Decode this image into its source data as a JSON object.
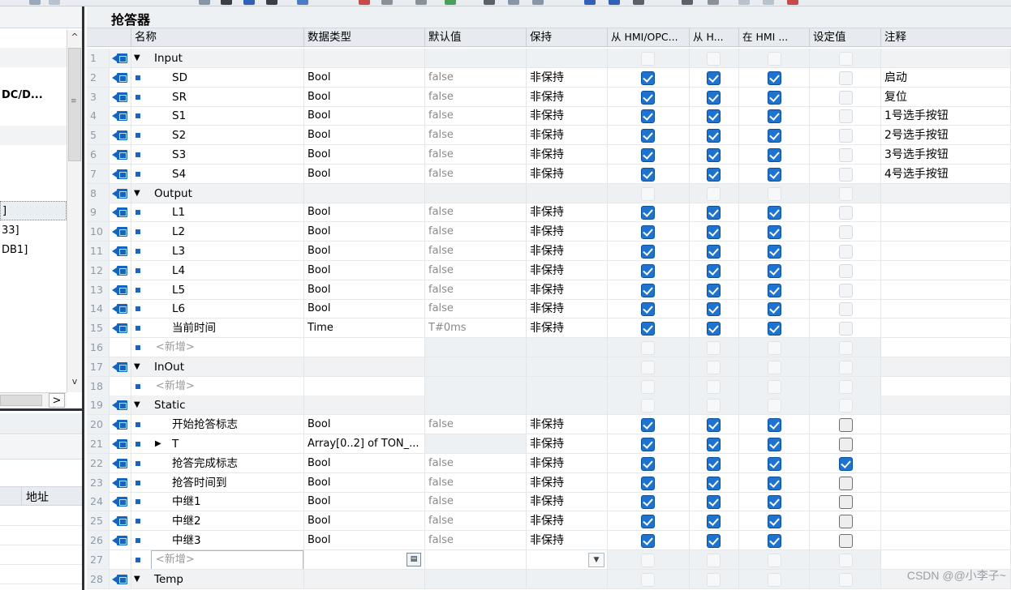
{
  "main": {
    "title": "抢答器",
    "columns": {
      "name": "名称",
      "datatype": "数据类型",
      "default": "默认值",
      "retain": "保持",
      "hmi_opc": "从 HMI/OPC...",
      "hmi2": "从 H...",
      "hmi3": "在 HMI ...",
      "setpoint": "设定值",
      "comment": "注释"
    },
    "rows": [
      {
        "num": "1",
        "icon": true,
        "kind": "group",
        "exp": "down",
        "name": "Input",
        "type": "",
        "def": "",
        "ret": "",
        "cb": [
          "off",
          "off",
          "off",
          "off"
        ],
        "cmt": ""
      },
      {
        "num": "2",
        "icon": true,
        "kind": "var",
        "name": "SD",
        "type": "Bool",
        "def": "false",
        "ret": "非保持",
        "cb": [
          "on",
          "on",
          "on",
          "off"
        ],
        "cmt": "启动"
      },
      {
        "num": "3",
        "icon": true,
        "kind": "var",
        "name": "SR",
        "type": "Bool",
        "def": "false",
        "ret": "非保持",
        "cb": [
          "on",
          "on",
          "on",
          "off"
        ],
        "cmt": "复位"
      },
      {
        "num": "4",
        "icon": true,
        "kind": "var",
        "name": "S1",
        "type": "Bool",
        "def": "false",
        "ret": "非保持",
        "cb": [
          "on",
          "on",
          "on",
          "off"
        ],
        "cmt": "1号选手按钮"
      },
      {
        "num": "5",
        "icon": true,
        "kind": "var",
        "name": "S2",
        "type": "Bool",
        "def": "false",
        "ret": "非保持",
        "cb": [
          "on",
          "on",
          "on",
          "off"
        ],
        "cmt": "2号选手按钮"
      },
      {
        "num": "6",
        "icon": true,
        "kind": "var",
        "name": "S3",
        "type": "Bool",
        "def": "false",
        "ret": "非保持",
        "cb": [
          "on",
          "on",
          "on",
          "off"
        ],
        "cmt": "3号选手按钮"
      },
      {
        "num": "7",
        "icon": true,
        "kind": "var",
        "name": "S4",
        "type": "Bool",
        "def": "false",
        "ret": "非保持",
        "cb": [
          "on",
          "on",
          "on",
          "off"
        ],
        "cmt": "4号选手按钮"
      },
      {
        "num": "8",
        "icon": true,
        "kind": "group",
        "exp": "down",
        "name": "Output",
        "type": "",
        "def": "",
        "ret": "",
        "cb": [
          "off",
          "off",
          "off",
          "off"
        ],
        "cmt": ""
      },
      {
        "num": "9",
        "icon": true,
        "kind": "var",
        "name": "L1",
        "type": "Bool",
        "def": "false",
        "ret": "非保持",
        "cb": [
          "on",
          "on",
          "on",
          "off"
        ],
        "cmt": ""
      },
      {
        "num": "10",
        "icon": true,
        "kind": "var",
        "name": "L2",
        "type": "Bool",
        "def": "false",
        "ret": "非保持",
        "cb": [
          "on",
          "on",
          "on",
          "off"
        ],
        "cmt": ""
      },
      {
        "num": "11",
        "icon": true,
        "kind": "var",
        "name": "L3",
        "type": "Bool",
        "def": "false",
        "ret": "非保持",
        "cb": [
          "on",
          "on",
          "on",
          "off"
        ],
        "cmt": ""
      },
      {
        "num": "12",
        "icon": true,
        "kind": "var",
        "name": "L4",
        "type": "Bool",
        "def": "false",
        "ret": "非保持",
        "cb": [
          "on",
          "on",
          "on",
          "off"
        ],
        "cmt": ""
      },
      {
        "num": "13",
        "icon": true,
        "kind": "var",
        "name": "L5",
        "type": "Bool",
        "def": "false",
        "ret": "非保持",
        "cb": [
          "on",
          "on",
          "on",
          "off"
        ],
        "cmt": ""
      },
      {
        "num": "14",
        "icon": true,
        "kind": "var",
        "name": "L6",
        "type": "Bool",
        "def": "false",
        "ret": "非保持",
        "cb": [
          "on",
          "on",
          "on",
          "off"
        ],
        "cmt": ""
      },
      {
        "num": "15",
        "icon": true,
        "kind": "var",
        "name": "当前时间",
        "type": "Time",
        "def": "T#0ms",
        "ret": "非保持",
        "cb": [
          "on",
          "on",
          "on",
          "off"
        ],
        "cmt": ""
      },
      {
        "num": "16",
        "icon": false,
        "kind": "add",
        "name": "<新增>",
        "type": "",
        "def": "",
        "ret": "",
        "cb": [
          "off",
          "off",
          "off",
          "off"
        ],
        "cmt": ""
      },
      {
        "num": "17",
        "icon": true,
        "kind": "group",
        "exp": "down",
        "name": "InOut",
        "type": "",
        "def": "",
        "ret": "",
        "cb": [
          "off",
          "off",
          "off",
          "off"
        ],
        "cmt": ""
      },
      {
        "num": "18",
        "icon": false,
        "kind": "add",
        "name": "<新增>",
        "type": "",
        "def": "",
        "ret": "",
        "cb": [
          "off",
          "off",
          "off",
          "off"
        ],
        "cmt": ""
      },
      {
        "num": "19",
        "icon": true,
        "kind": "group",
        "exp": "down",
        "name": "Static",
        "type": "",
        "def": "",
        "ret": "",
        "cb": [
          "off",
          "off",
          "off",
          "off"
        ],
        "cmt": ""
      },
      {
        "num": "20",
        "icon": true,
        "kind": "var",
        "name": "开始抢答标志",
        "type": "Bool",
        "def": "false",
        "ret": "非保持",
        "cb": [
          "on",
          "on",
          "on",
          "offdark"
        ],
        "cmt": ""
      },
      {
        "num": "21",
        "icon": true,
        "kind": "var",
        "exp": "right",
        "name": "T",
        "type": "Array[0..2] of TON_...",
        "def": "",
        "ret": "非保持",
        "cb": [
          "on",
          "on",
          "on",
          "offdark"
        ],
        "cmt": ""
      },
      {
        "num": "22",
        "icon": true,
        "kind": "var",
        "name": "抢答完成标志",
        "type": "Bool",
        "def": "false",
        "ret": "非保持",
        "cb": [
          "on",
          "on",
          "on",
          "on"
        ],
        "cmt": ""
      },
      {
        "num": "23",
        "icon": true,
        "kind": "var",
        "name": "抢答时间到",
        "type": "Bool",
        "def": "false",
        "ret": "非保持",
        "cb": [
          "on",
          "on",
          "on",
          "offdark"
        ],
        "cmt": ""
      },
      {
        "num": "24",
        "icon": true,
        "kind": "var",
        "name": "中继1",
        "type": "Bool",
        "def": "false",
        "ret": "非保持",
        "cb": [
          "on",
          "on",
          "on",
          "offdark"
        ],
        "cmt": ""
      },
      {
        "num": "25",
        "icon": true,
        "kind": "var",
        "name": "中继2",
        "type": "Bool",
        "def": "false",
        "ret": "非保持",
        "cb": [
          "on",
          "on",
          "on",
          "offdark"
        ],
        "cmt": ""
      },
      {
        "num": "26",
        "icon": true,
        "kind": "var",
        "name": "中继3",
        "type": "Bool",
        "def": "false",
        "ret": "非保持",
        "cb": [
          "on",
          "on",
          "on",
          "offdark"
        ],
        "cmt": ""
      },
      {
        "num": "27",
        "icon": false,
        "kind": "edit",
        "name": "<新增>",
        "type": "",
        "def": "",
        "ret": "",
        "cb": [
          "off",
          "off",
          "off",
          "off"
        ],
        "cmt": ""
      },
      {
        "num": "28",
        "icon": true,
        "kind": "group",
        "exp": "down",
        "name": "Temp",
        "type": "",
        "def": "",
        "ret": "",
        "cb": [
          "off",
          "off",
          "off",
          "off"
        ],
        "cmt": ""
      }
    ]
  },
  "left_panel": {
    "items": [
      "DC/D...",
      "]",
      "33]",
      "DB1]"
    ],
    "address_header": "地址",
    "hscroll_arrow": ">",
    "vscroll_up": "^",
    "vscroll_down": "v"
  },
  "icons": {
    "expand_down": "▼",
    "expand_right": "▶",
    "browse": "▤",
    "dropdown": "▼"
  },
  "watermark": "CSDN @@小李子~",
  "colors": {
    "checkbox_on": "#1d73cf",
    "interface_icon": "#1565c0",
    "header_bg": "#e7ebef"
  }
}
